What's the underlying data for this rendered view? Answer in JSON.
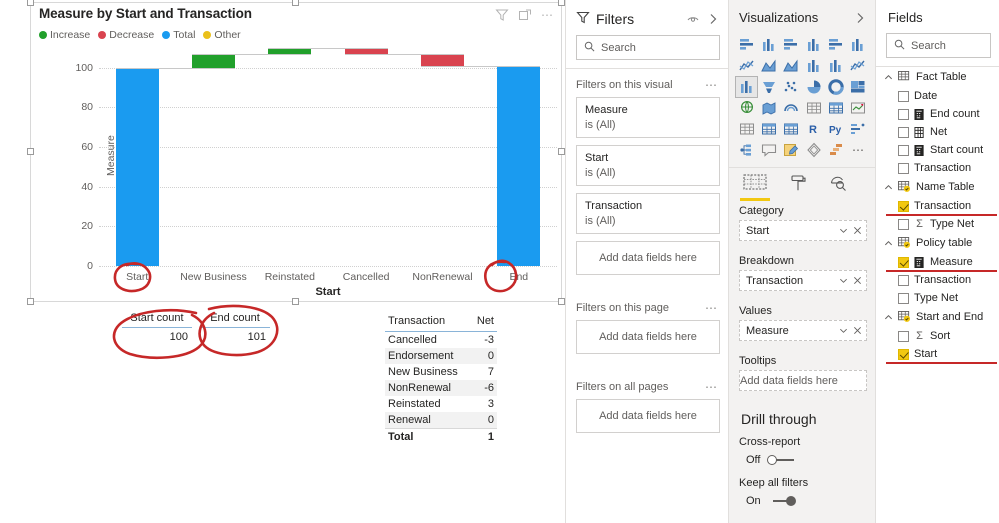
{
  "chart_data": {
    "type": "bar",
    "subtype": "waterfall",
    "title": "Measure by Start and Transaction",
    "xlabel": "Start",
    "ylabel": "Measure",
    "ylim": [
      0,
      110
    ],
    "yticks": [
      0,
      20,
      40,
      60,
      80,
      100
    ],
    "grid": true,
    "legend_position": "top-left",
    "legend": [
      {
        "label": "Increase",
        "color": "#21a02b"
      },
      {
        "label": "Decrease",
        "color": "#d9434f"
      },
      {
        "label": "Total",
        "color": "#1a9bf0"
      },
      {
        "label": "Other",
        "color": "#eac01a"
      }
    ],
    "categories": [
      "Start",
      "New Business",
      "Reinstated",
      "Cancelled",
      "NonRenewal",
      "End"
    ],
    "values": [
      100,
      7,
      3,
      -3,
      -6,
      101
    ],
    "kinds": [
      "total",
      "increase",
      "increase",
      "decrease",
      "decrease",
      "total"
    ],
    "bar_bases": [
      0,
      100,
      107,
      110,
      107,
      0
    ],
    "bar_tops": [
      100,
      107,
      110,
      107,
      101,
      101
    ]
  },
  "visual_header": {
    "title": "Measure by Start and Transaction",
    "icons": [
      "filter-icon",
      "focus-mode-icon",
      "more-options-icon"
    ]
  },
  "cards": [
    {
      "title": "Start count",
      "value": "100"
    },
    {
      "title": "End count",
      "value": "101"
    }
  ],
  "transaction_table": {
    "columns": [
      "Transaction",
      "Net"
    ],
    "rows": [
      {
        "transaction": "Cancelled",
        "net": "-3"
      },
      {
        "transaction": "Endorsement",
        "net": "0"
      },
      {
        "transaction": "New Business",
        "net": "7"
      },
      {
        "transaction": "NonRenewal",
        "net": "-6"
      },
      {
        "transaction": "Reinstated",
        "net": "3"
      },
      {
        "transaction": "Renewal",
        "net": "0"
      }
    ],
    "total": {
      "transaction": "Total",
      "net": "1"
    }
  },
  "filters_pane": {
    "title": "Filters",
    "search_placeholder": "Search",
    "sections": [
      {
        "label": "Filters on this visual",
        "cards": [
          {
            "name": "Measure",
            "value": "is (All)"
          },
          {
            "name": "Start",
            "value": "is (All)"
          },
          {
            "name": "Transaction",
            "value": "is (All)"
          }
        ],
        "dropzone": "Add data fields here"
      },
      {
        "label": "Filters on this page",
        "cards": [],
        "dropzone": "Add data fields here"
      },
      {
        "label": "Filters on all pages",
        "cards": [],
        "dropzone": "Add data fields here"
      }
    ]
  },
  "visualizations_pane": {
    "title": "Visualizations",
    "tabs": [
      {
        "name": "fields-tab",
        "active": true
      },
      {
        "name": "format-tab",
        "active": false
      },
      {
        "name": "analytics-tab",
        "active": false
      }
    ],
    "wells": [
      {
        "label": "Category",
        "value": "Start",
        "empty": false
      },
      {
        "label": "Breakdown",
        "value": "Transaction",
        "empty": false
      },
      {
        "label": "Values",
        "value": "Measure",
        "empty": false
      },
      {
        "label": "Tooltips",
        "value": "Add data fields here",
        "empty": true
      }
    ],
    "drill_through": {
      "title": "Drill through",
      "cross_report": {
        "label": "Cross-report",
        "state": "Off",
        "on": false
      },
      "keep_all_filters": {
        "label": "Keep all filters",
        "state": "On",
        "on": true
      }
    }
  },
  "fields_pane": {
    "title": "Fields",
    "search_placeholder": "Search",
    "tables": [
      {
        "name": "Fact Table",
        "checked": false,
        "fields": [
          {
            "name": "Date",
            "checked": false,
            "icon": "none",
            "highlight": false
          },
          {
            "name": "End count",
            "checked": false,
            "icon": "measure",
            "highlight": false
          },
          {
            "name": "Net",
            "checked": false,
            "icon": "calc-table",
            "highlight": false
          },
          {
            "name": "Start count",
            "checked": false,
            "icon": "measure",
            "highlight": false
          },
          {
            "name": "Transaction",
            "checked": false,
            "icon": "none",
            "highlight": false
          }
        ]
      },
      {
        "name": "Name Table",
        "checked": true,
        "fields": [
          {
            "name": "Transaction",
            "checked": true,
            "icon": "none",
            "highlight": true
          },
          {
            "name": "Type Net",
            "checked": false,
            "icon": "sigma",
            "highlight": false
          }
        ]
      },
      {
        "name": "Policy table",
        "checked": true,
        "fields": [
          {
            "name": "Measure",
            "checked": true,
            "icon": "measure",
            "highlight": true
          },
          {
            "name": "Transaction",
            "checked": false,
            "icon": "none",
            "highlight": false
          },
          {
            "name": "Type Net",
            "checked": false,
            "icon": "none",
            "highlight": false
          }
        ]
      },
      {
        "name": "Start and End",
        "checked": true,
        "fields": [
          {
            "name": "Sort",
            "checked": false,
            "icon": "sigma",
            "highlight": false
          },
          {
            "name": "Start",
            "checked": true,
            "icon": "none",
            "highlight": true
          }
        ]
      }
    ]
  },
  "annotation": {
    "color": "#c62828",
    "marks": [
      "ellipse-start-axis-label",
      "ellipse-end-axis-label",
      "ellipse-start-count-card",
      "ellipse-end-count-card"
    ]
  }
}
